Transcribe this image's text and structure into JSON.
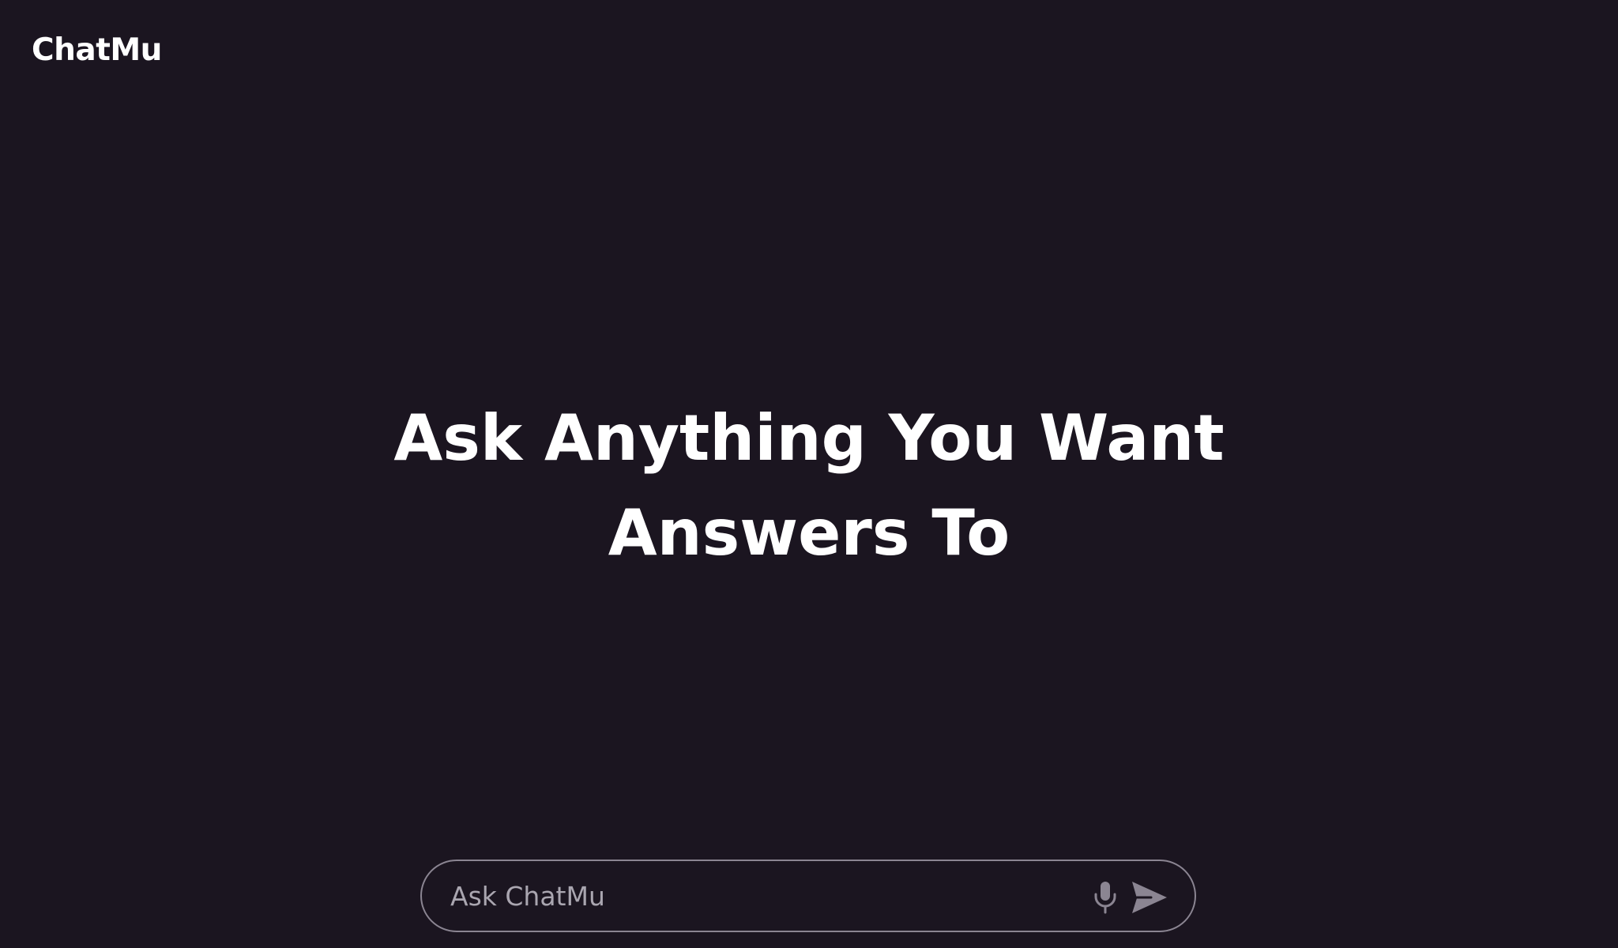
{
  "app": {
    "logo": "ChatMu"
  },
  "hero": {
    "line1": "Ask Anything You Want",
    "line2": "Answers To"
  },
  "composer": {
    "placeholder": "Ask ChatMu",
    "value": "",
    "icons": {
      "voice": "microphone-icon",
      "send": "send-icon"
    }
  },
  "colors": {
    "background": "#1b1520",
    "text": "#ffffff",
    "muted": "#aaa6b0",
    "border": "#8b8592",
    "icon": "#8b8592"
  }
}
